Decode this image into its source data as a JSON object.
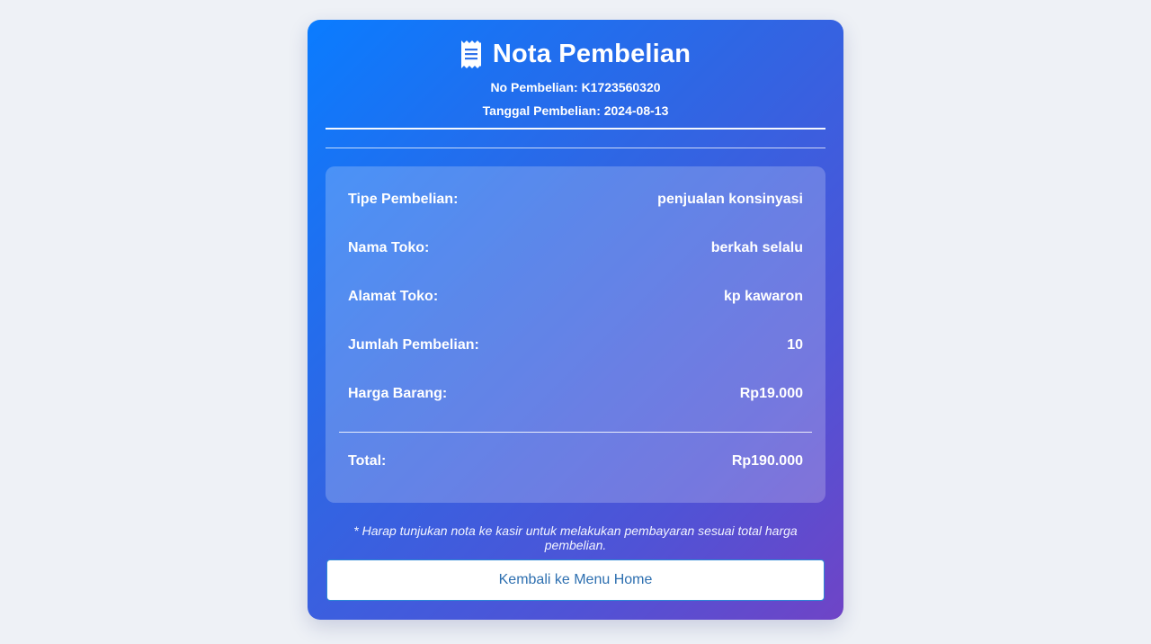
{
  "receipt": {
    "title": "Nota Pembelian",
    "icon": "receipt-icon",
    "no_pembelian": "No Pembelian: K1723560320",
    "tanggal_pembelian": "Tanggal Pembelian: 2024-08-13",
    "rows": [
      {
        "label": "Tipe Pembelian:",
        "value": "penjualan konsinyasi"
      },
      {
        "label": "Nama Toko:",
        "value": "berkah selalu"
      },
      {
        "label": "Alamat Toko:",
        "value": "kp kawaron"
      },
      {
        "label": "Jumlah Pembelian:",
        "value": "10"
      },
      {
        "label": "Harga Barang:",
        "value": "Rp19.000"
      }
    ],
    "total": {
      "label": "Total:",
      "value": "Rp190.000"
    },
    "note": "* Harap tunjukan nota ke kasir untuk melakukan pembayaran sesuai total harga pembelian.",
    "home_button": "Kembali ke Menu Home"
  },
  "colors": {
    "page_background": "#eef1f6",
    "gradient_start": "#0a7cff",
    "gradient_end": "#6f44c6",
    "button_text": "#2d6fb0"
  }
}
